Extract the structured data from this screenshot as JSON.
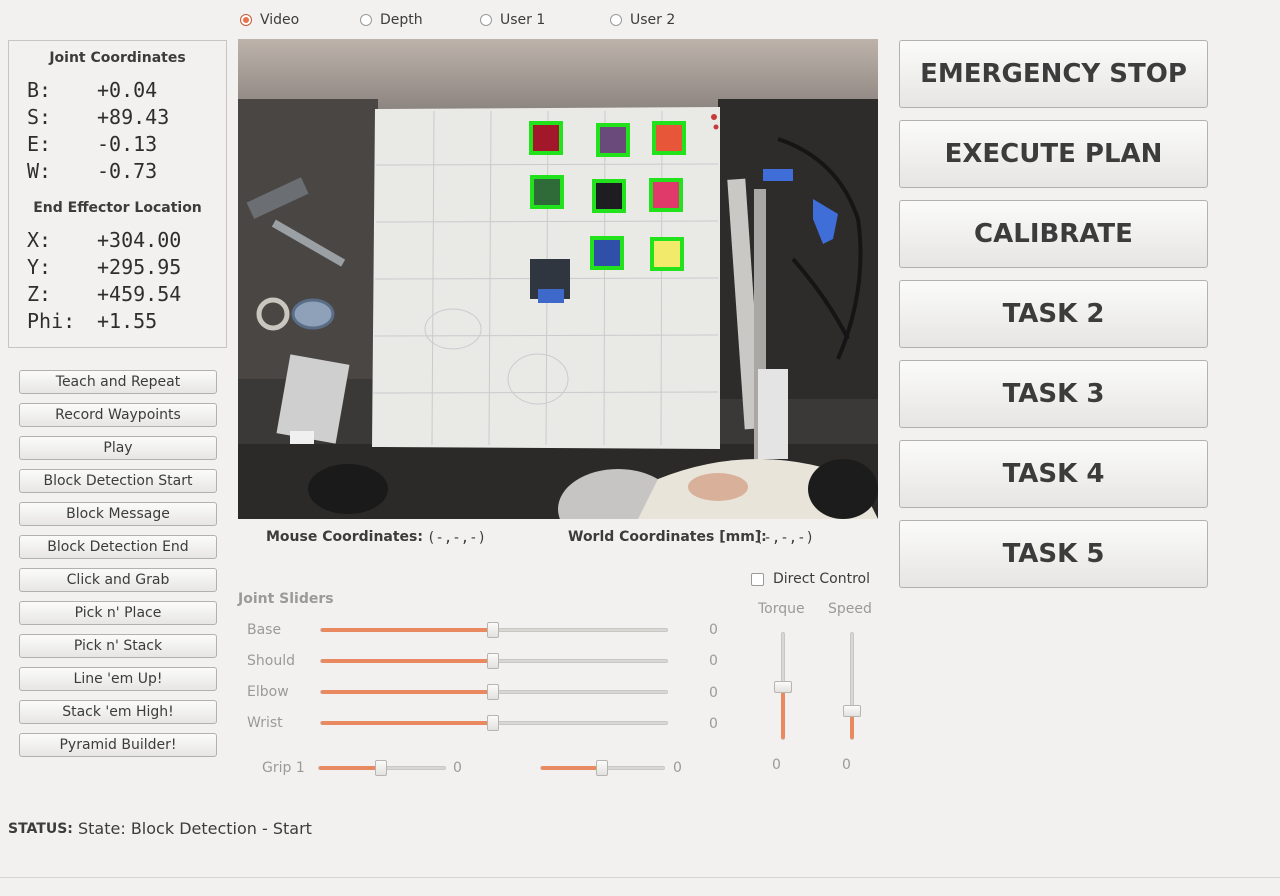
{
  "view_modes": [
    {
      "label": "Video",
      "selected": true
    },
    {
      "label": "Depth",
      "selected": false
    },
    {
      "label": "User 1",
      "selected": false
    },
    {
      "label": "User 2",
      "selected": false
    }
  ],
  "joint_panel": {
    "title": "Joint Coordinates",
    "rows": [
      {
        "label": "B:",
        "value": "+0.04"
      },
      {
        "label": "S:",
        "value": "+89.43"
      },
      {
        "label": "E:",
        "value": "-0.13"
      },
      {
        "label": "W:",
        "value": "-0.73"
      }
    ]
  },
  "ee_panel": {
    "title": "End Effector Location",
    "rows": [
      {
        "label": "X:",
        "value": "+304.00"
      },
      {
        "label": "Y:",
        "value": "+295.95"
      },
      {
        "label": "Z:",
        "value": "+459.54"
      },
      {
        "label": "Phi:",
        "value": "+1.55"
      }
    ]
  },
  "left_buttons": [
    "Teach and Repeat",
    "Record Waypoints",
    "Play",
    "Block Detection Start",
    "Block Message",
    "Block Detection End",
    "Click and Grab",
    "Pick n' Place",
    "Pick n' Stack",
    "Line 'em Up!",
    "Stack 'em High!",
    "Pyramid Builder!"
  ],
  "coords": {
    "mouse_label": "Mouse Coordinates:",
    "mouse_value": "(-,-,-)",
    "world_label": "World Coordinates [mm]:",
    "world_value": "(-,-,-)"
  },
  "sliders": {
    "title": "Joint Sliders",
    "joints": [
      {
        "label": "Base",
        "value": "0",
        "fraction": 0.5
      },
      {
        "label": "Should",
        "value": "0",
        "fraction": 0.5
      },
      {
        "label": "Elbow",
        "value": "0",
        "fraction": 0.5
      },
      {
        "label": "Wrist",
        "value": "0",
        "fraction": 0.5
      }
    ],
    "grip1": {
      "label": "Grip 1",
      "value": "0",
      "fraction": 0.5
    },
    "grip2": {
      "value": "0",
      "fraction": 0.5
    }
  },
  "direct_control": {
    "label": "Direct Control",
    "checked": false
  },
  "torque": {
    "label": "Torque",
    "value": "0",
    "fraction": 0.5
  },
  "speed": {
    "label": "Speed",
    "value": "0",
    "fraction": 0.27
  },
  "big_buttons": [
    "EMERGENCY STOP",
    "EXECUTE PLAN",
    "CALIBRATE",
    "TASK 2",
    "TASK 3",
    "TASK 4",
    "TASK 5"
  ],
  "status": {
    "label": "STATUS:",
    "text": "State: Block Detection - Start"
  },
  "colors": {
    "accent": "#e9895f",
    "detection_box": "#22e31b"
  },
  "blocks": [
    {
      "color": "#a3172a"
    },
    {
      "color": "#6a4a7a"
    },
    {
      "color": "#e8563a"
    },
    {
      "color": "#2f6b39"
    },
    {
      "color": "#1e1e22"
    },
    {
      "color": "#e03a6a"
    },
    {
      "color": "#2f4fa8"
    },
    {
      "color": "#f1ea6a"
    }
  ]
}
